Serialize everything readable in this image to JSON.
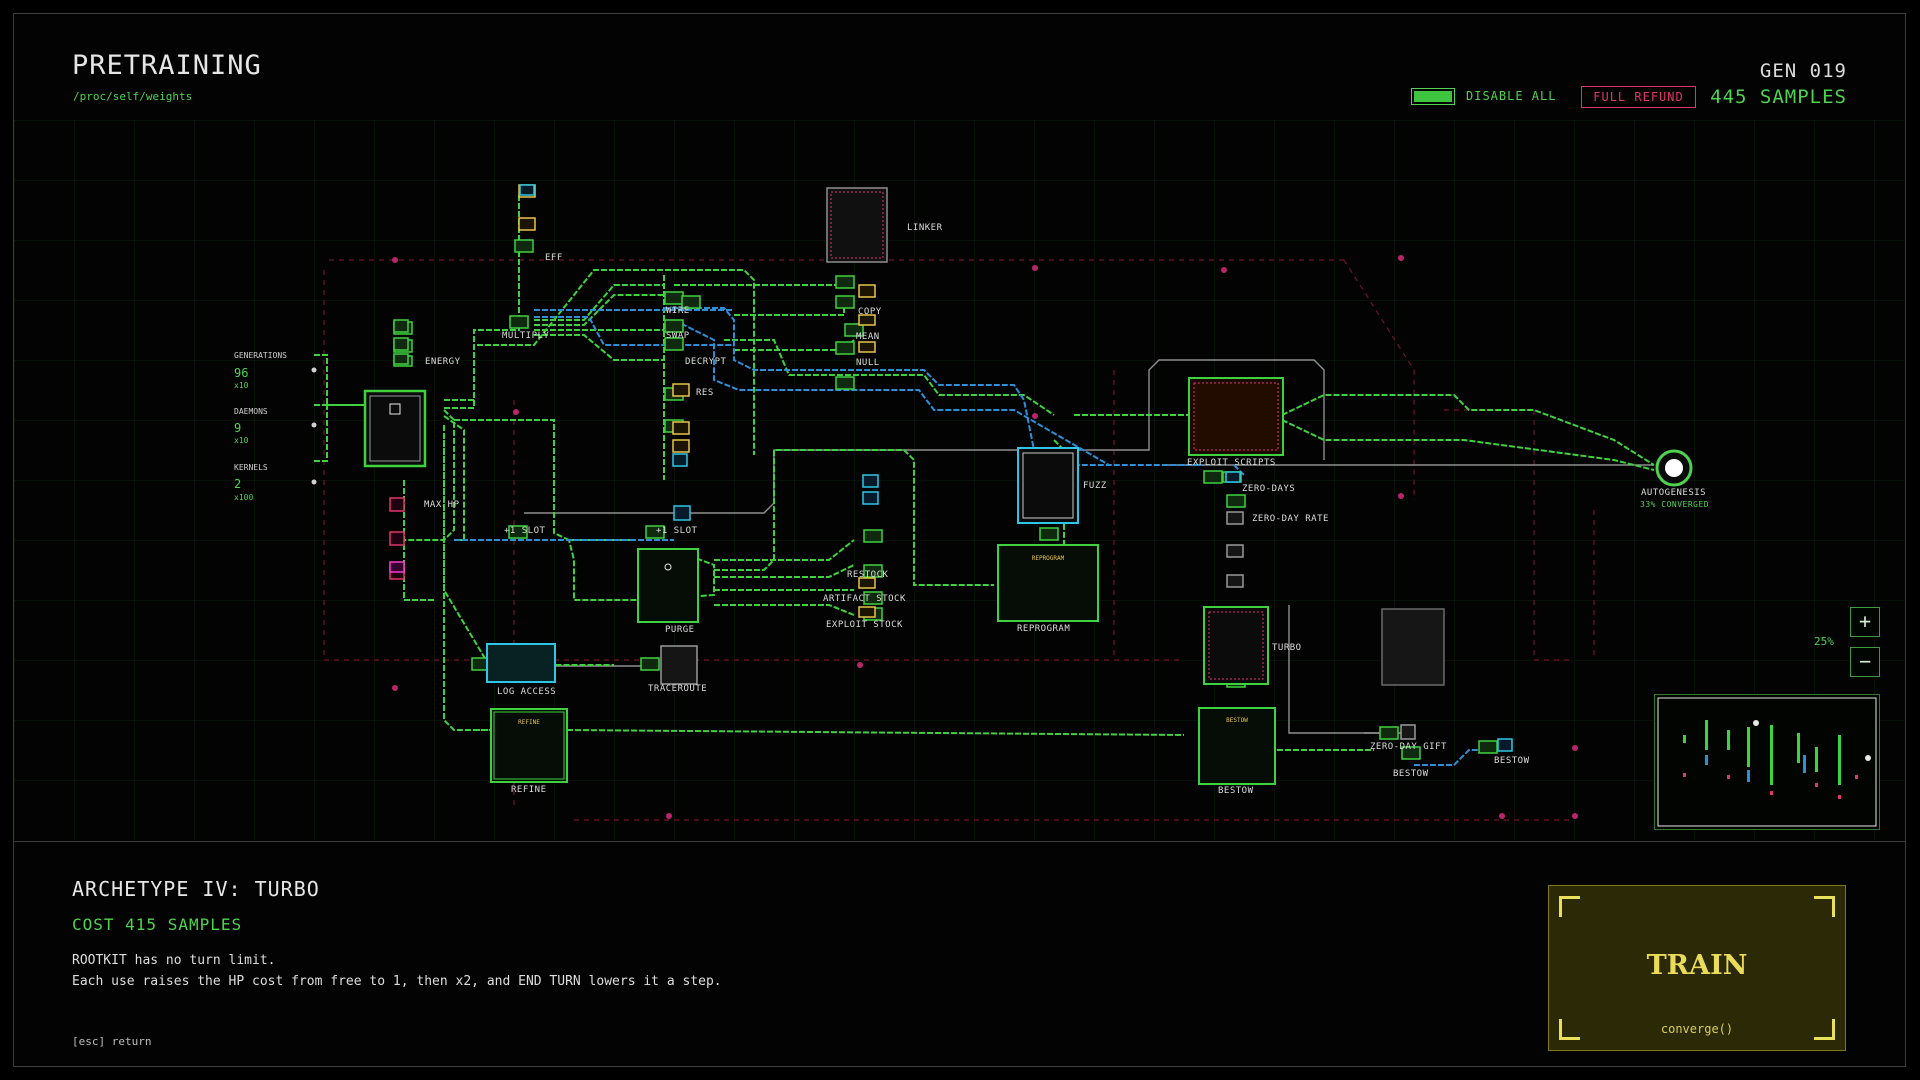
{
  "header": {
    "title": "PRETRAINING",
    "path": "/proc/self/weights",
    "generation": "GEN 019",
    "samples": "445 SAMPLES",
    "disable_all_label": "DISABLE ALL",
    "full_refund_label": "FULL REFUND"
  },
  "stats": {
    "generations_label": "GENERATIONS",
    "generations_value": "96",
    "generations_mult": "x10",
    "daemons_label": "DAEMONS",
    "daemons_value": "9",
    "daemons_mult": "x10",
    "kernels_label": "KERNELS",
    "kernels_value": "2",
    "kernels_mult": "x100"
  },
  "nodes": {
    "energy": "ENERGY",
    "max_hp": "MAX HP",
    "eff": "EFF",
    "multiply": "MULTIPLY",
    "linker": "LINKER",
    "wire": "WIRE",
    "swap": "SWAP",
    "decrypt": "DECRYPT",
    "res": "RES",
    "copy": "COPY",
    "mean": "MEAN",
    "null": "NULL",
    "slot1": "+1 SLOT",
    "slot2": "+1 SLOT",
    "purge": "PURGE",
    "restock": "RESTOCK",
    "artifact_stock": "ARTIFACT STOCK",
    "exploit_stock": "EXPLOIT STOCK",
    "log_access": "LOG ACCESS",
    "traceroute": "TRACEROUTE",
    "refine": "REFINE",
    "fuzz": "FUZZ",
    "reprogram": "REPROGRAM",
    "exploit_scripts": "EXPLOIT SCRIPTS",
    "zero_days": "ZERO-DAYS",
    "zero_day_rate": "ZERO-DAY RATE",
    "turbo": "TURBO",
    "bestow": "BESTOW",
    "bestow2": "BESTOW",
    "bestow3": "BESTOW",
    "zero_day_gift": "ZERO-DAY GIFT",
    "autogenesis": "AUTOGENESIS",
    "autogenesis_sub": "33% CONVERGED"
  },
  "zoom": {
    "plus": "+",
    "minus": "−",
    "level": "25%"
  },
  "details": {
    "archetype": "ARCHETYPE IV: TURBO",
    "cost": "COST 415 SAMPLES",
    "line1": "ROOTKIT has no turn limit.",
    "line2": "Each use raises the HP cost from free to 1, then x2, and END TURN lowers it a step.",
    "esc": "[esc] return"
  },
  "train": {
    "label": "TRAIN",
    "sub": "converge()"
  },
  "colors": {
    "accent_green": "#4fd34f",
    "wire_blue": "#2e8fd6",
    "refund_red": "#e0356a",
    "train_yellow": "#e8dc5a",
    "locked_gray": "#9a9a9a"
  }
}
